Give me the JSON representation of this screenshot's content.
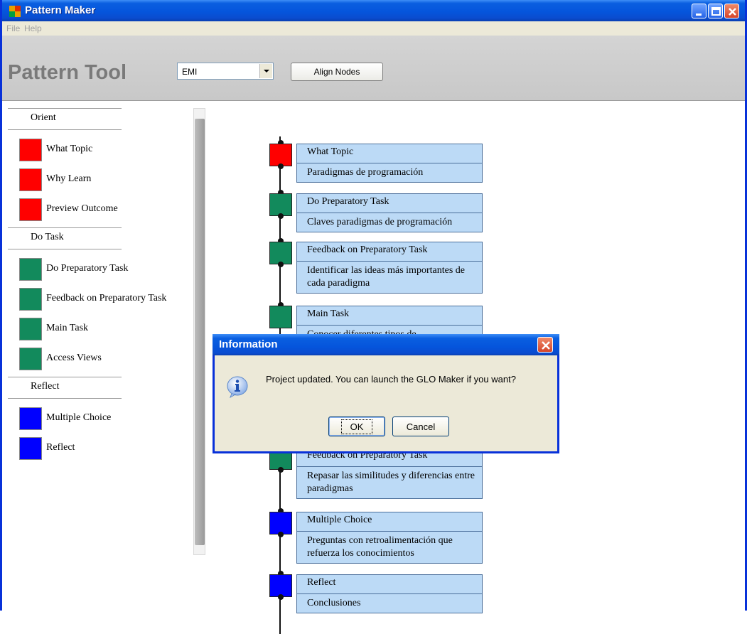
{
  "window": {
    "title": "Pattern Maker",
    "colors": {
      "titlebar": "#0555dc",
      "close": "#d4452a"
    }
  },
  "menu": {
    "items": [
      "File",
      "Help"
    ]
  },
  "toolbar": {
    "heading": "Pattern Tool",
    "select_value": "EMI",
    "align_label": "Align Nodes"
  },
  "sidebar": {
    "sections": [
      {
        "label": "Orient",
        "items": [
          {
            "label": "What Topic",
            "color": "#ff0000"
          },
          {
            "label": "Why Learn",
            "color": "#ff0000"
          },
          {
            "label": "Preview Outcome",
            "color": "#ff0000"
          }
        ]
      },
      {
        "label": "Do Task",
        "items": [
          {
            "label": "Do Preparatory Task",
            "color": "#128a5c"
          },
          {
            "label": "Feedback on Preparatory Task",
            "color": "#128a5c"
          },
          {
            "label": "Main Task",
            "color": "#128a5c"
          },
          {
            "label": "Access Views",
            "color": "#128a5c"
          }
        ]
      },
      {
        "label": "Reflect",
        "items": [
          {
            "label": "Multiple Choice",
            "color": "#0000ff"
          },
          {
            "label": "Reflect",
            "color": "#0000ff"
          }
        ]
      }
    ]
  },
  "nodes": [
    {
      "title": "What Topic",
      "desc": "Paradigmas de programación",
      "color": "#ff0000"
    },
    {
      "title": "Do Preparatory Task",
      "desc": "Claves paradigmas de programación",
      "color": "#128a5c"
    },
    {
      "title": "Feedback on Preparatory Task",
      "desc": "Identificar las ideas más importantes de cada paradigma",
      "color": "#128a5c"
    },
    {
      "title": "Main Task",
      "desc": "Conocer diferentes tipos de",
      "color": "#128a5c"
    },
    {
      "title": "Feedback on Preparatory Task",
      "desc": "Repasar las similitudes y diferencias entre paradigmas",
      "color": "#128a5c"
    },
    {
      "title": "Multiple Choice",
      "desc": "Preguntas con retroalimentación que refuerza los conocimientos",
      "color": "#0000ff"
    },
    {
      "title": "Reflect",
      "desc": "Conclusiones",
      "color": "#0000ff"
    }
  ],
  "dialog": {
    "title": "Information",
    "message": "Project updated. You can launch the GLO Maker if you want?",
    "ok_label": "OK",
    "cancel_label": "Cancel"
  }
}
